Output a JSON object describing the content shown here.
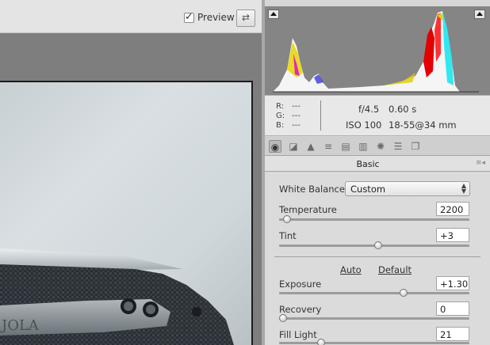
{
  "toolbar": {
    "preview_label": "Preview",
    "preview_checked": true,
    "swap_icon": "swap-arrows-icon"
  },
  "info": {
    "r_label": "R:",
    "r_value": "---",
    "g_label": "G:",
    "g_value": "---",
    "b_label": "B:",
    "b_value": "---",
    "aperture": "f/4.5",
    "shutter": "0.60 s",
    "iso": "ISO 100",
    "lens": "18-55@34 mm"
  },
  "tools": [
    "basic-icon",
    "tone-curve-icon",
    "detail-icon",
    "hsl-icon",
    "split-toning-icon",
    "lens-corrections-icon",
    "effects-icon",
    "camera-calibration-icon",
    "presets-icon"
  ],
  "panel": {
    "title": "Basic",
    "white_balance_label": "White Balance:",
    "white_balance_value": "Custom",
    "auto_label": "Auto",
    "default_label": "Default",
    "sliders": [
      {
        "label": "Temperature",
        "value": "2200",
        "level": 0.02
      },
      {
        "label": "Tint",
        "value": "+3",
        "level": 0.52
      },
      {
        "label": "Exposure",
        "value": "+1.30",
        "level": 0.66
      },
      {
        "label": "Recovery",
        "value": "0",
        "level": 0.0
      },
      {
        "label": "Fill Light",
        "value": "21",
        "level": 0.21
      }
    ]
  },
  "photo": {
    "engraving_text": "JOLA"
  },
  "colors": {
    "histogram_bg": "#858585",
    "panel_bg": "#dbdbdb",
    "photo_bg": "#d0d7da"
  }
}
